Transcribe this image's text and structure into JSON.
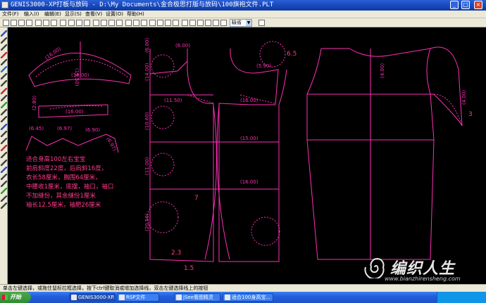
{
  "window": {
    "title": "GENIS3000-XP打板与放码 - D:\\My Documents\\金合极思打版与放码\\100旗袍文件.PLT",
    "minimize": "_",
    "maximize": "□",
    "close": "×"
  },
  "menu": [
    "文件(F)",
    "输入(I)",
    "编辑(E)",
    "显示(S)",
    "查看(V)",
    "设置(O)",
    "帮助(H)"
  ],
  "toolbar": {
    "layer_select": "缺省",
    "icons": [
      "new-icon",
      "open-icon",
      "save-icon",
      "print-icon",
      "cut-icon",
      "copy-icon",
      "paste-icon",
      "undo-icon",
      "pen-icon",
      "hand-icon",
      "redo-icon",
      "zoom-icon",
      "ruler-icon",
      "grid-icon",
      "node-icon",
      "measure-icon",
      "mirror-icon",
      "rotate-icon",
      "zoom-in-icon",
      "zoom-out-icon",
      "zoom-fit-icon",
      "zoom-window-icon",
      "select-icon",
      "text-icon",
      "layer-icon",
      "color-icon",
      "fill-icon",
      "line-icon",
      "point-icon"
    ]
  },
  "sidebar_icons": [
    "pointer-icon",
    "line-tool-icon",
    "curve-tool-icon",
    "arc-tool-icon",
    "dart-tool-icon",
    "pleat-tool-icon",
    "circle-tool-icon",
    "rect-tool-icon",
    "notch-tool-icon",
    "cut-tool-icon",
    "mirror-tool-icon",
    "rotate-tool-icon",
    "grade-tool-icon",
    "text-tool-icon",
    "measure-tool-icon",
    "seam-tool-icon",
    "pattern-tool-icon",
    "grain-tool-icon",
    "button-tool-icon",
    "zoom-tool-icon",
    "pan-tool-icon",
    "erase-tool-icon",
    "move-tool-icon",
    "copy-tool-icon",
    "join-tool-icon"
  ],
  "canvas": {
    "colors": {
      "line": "#ff2fb4",
      "text": "#ff3a8c",
      "dims": "#ff2fb4"
    },
    "sleeve_labels": [
      "(16.00)",
      "(15.50)",
      "(16.00)"
    ],
    "collar_labels": [
      "(2.80)",
      "(16.00)"
    ],
    "band_labels": [
      "(6.45)",
      "(6.97)",
      "(6.90)",
      "(6.97)"
    ],
    "bodice_labels": [
      "(6.00)",
      "(6.00)",
      "(5.90)",
      "(11.50)",
      "(14.00)",
      "(10.60)",
      "(11.00)",
      "(20.50)",
      "(16.00)",
      "(15.00)",
      "(16.00)"
    ],
    "right_labels": [
      "(4.00)",
      "(4.00)"
    ],
    "markers": [
      "6.5",
      "7",
      "2.3",
      "1.5",
      "3"
    ],
    "notes": [
      "适合身高100左右宝宝",
      "前肩斜度22度，后肩斜16度，",
      "衣长58厘米，胸围64厘米，",
      "中腰收1厘米，底摆，袖口，袖口",
      "不加缝份，其余缝份1厘米",
      "袖长12.5厘米，袖肥26厘米"
    ]
  },
  "status": {
    "text": "单击左键选择，或拖住鼠标拉框选择，按下ctrl键取消或增加选择线，双击左键选择线上的按钮"
  },
  "taskbar": {
    "start": "开始",
    "tasks": [
      "GENIS3000-XP...",
      "RSP文件",
      "jSee看图精灵",
      "适合100身高宝..."
    ]
  },
  "watermark": {
    "brand": "编织人生",
    "url": "www.bianzhirensheng.com"
  }
}
